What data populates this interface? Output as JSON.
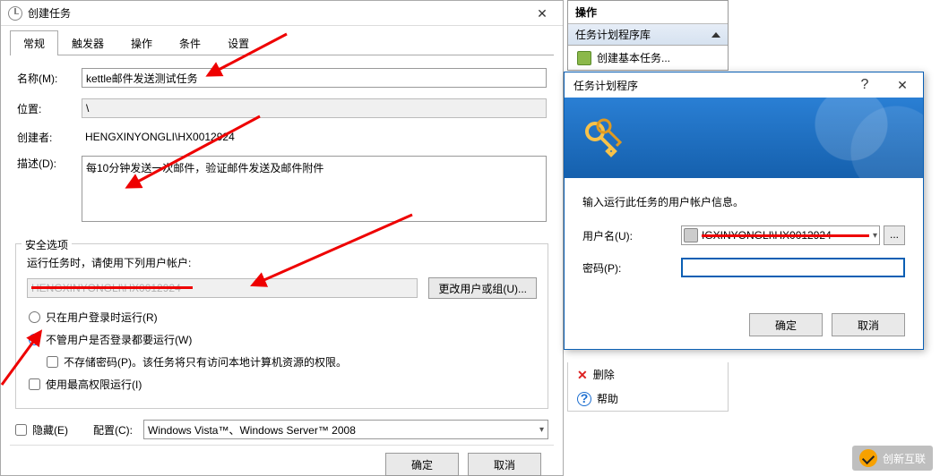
{
  "main": {
    "title": "创建任务",
    "tabs": [
      "常规",
      "触发器",
      "操作",
      "条件",
      "设置"
    ],
    "name_label": "名称(M):",
    "name_value": "kettle邮件发送测试任务",
    "location_label": "位置:",
    "location_value": "\\",
    "author_label": "创建者:",
    "author_value": "HENGXINYONGLI\\HX0012924",
    "desc_label": "描述(D):",
    "desc_value": "每10分钟发送一次邮件，验证邮件发送及邮件附件",
    "security": {
      "legend": "安全选项",
      "prompt": "运行任务时，请使用下列用户帐户:",
      "user": "HENGXINYONGLI\\HX0012924",
      "change_btn": "更改用户或组(U)...",
      "radio1": "只在用户登录时运行(R)",
      "radio2": "不管用户是否登录都要运行(W)",
      "check_nopwd": "不存储密码(P)。该任务将只有访问本地计算机资源的权限。",
      "check_priv": "使用最高权限运行(I)"
    },
    "hidden_label": "隐藏(E)",
    "config_label": "配置(C):",
    "config_value": "Windows Vista™、Windows Server™ 2008",
    "ok": "确定",
    "cancel": "取消"
  },
  "side": {
    "header": "操作",
    "group": "任务计划程序库",
    "item_create": "创建基本任务...",
    "item_proc": "",
    "item_delete": "删除",
    "item_help": "帮助"
  },
  "cred": {
    "title": "任务计划程序",
    "help": "?",
    "instr": "输入运行此任务的用户帐户信息。",
    "user_label": "用户名(U):",
    "user_value": "IGXINYONGLI\\HX0012924",
    "pass_label": "密码(P):",
    "ok": "确定",
    "cancel": "取消"
  },
  "logo": "创新互联"
}
